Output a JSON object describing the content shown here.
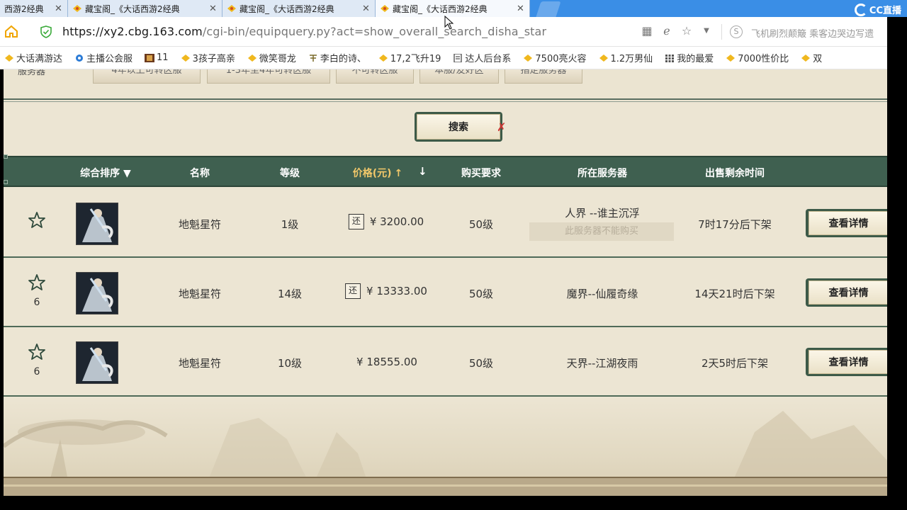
{
  "browser": {
    "tabs": [
      {
        "title": "西游2经典"
      },
      {
        "title": "藏宝阁_《大话西游2经典"
      },
      {
        "title": "藏宝阁_《大话西游2经典"
      },
      {
        "title": "藏宝阁_《大话西游2经典"
      }
    ],
    "url_domain": "https://xy2.cbg.163.com",
    "url_path": "/cgi-bin/equipquery.py?act=show_overall_search_disha_star",
    "address_hint": "飞机刷烈颠簸 乘客边哭边写遗",
    "stream_logo": "CC直播",
    "bookmarks": [
      {
        "label": "大话满游达"
      },
      {
        "label": "主播公会服"
      },
      {
        "label": "11"
      },
      {
        "label": "3孩子高亲"
      },
      {
        "label": "微笑哥龙"
      },
      {
        "label": "李白的诗、"
      },
      {
        "label": "17,2飞升19"
      },
      {
        "label": "达人后台系"
      },
      {
        "label": "7500亮火容"
      },
      {
        "label": "1.2万男仙"
      },
      {
        "label": "我的最爱"
      },
      {
        "label": "7000性价比"
      },
      {
        "label": "双"
      }
    ]
  },
  "filters": {
    "label": "服务器",
    "buttons": [
      "4年以上可转区服",
      "1-3年至4年可转区服",
      "不可转区服",
      "本服/友好区",
      "指定服务器"
    ]
  },
  "search": {
    "label": "搜索"
  },
  "table": {
    "headers": {
      "sort": "综合排序 ▼",
      "name": "名称",
      "level": "等级",
      "price": "价格(元)",
      "price_up": "↑",
      "price_down": "↓",
      "requirement": "购买要求",
      "server": "所在服务器",
      "time_left": "出售剩余时间"
    },
    "rows": [
      {
        "fav_count": "",
        "name": "地魁星符",
        "level": "1级",
        "refund_badge": "还",
        "price": "¥ 3200.00",
        "requirement": "50级",
        "server": "人界 --谁主沉浮",
        "server_note": "此服务器不能购买",
        "time_left": "7时17分后下架",
        "action": "查看详情"
      },
      {
        "fav_count": "6",
        "name": "地魁星符",
        "level": "14级",
        "refund_badge": "还",
        "price": "¥ 13333.00",
        "requirement": "50级",
        "server": "魔界--仙履奇缘",
        "server_note": "",
        "time_left": "14天21时后下架",
        "action": "查看详情"
      },
      {
        "fav_count": "6",
        "name": "地魁星符",
        "level": "10级",
        "refund_badge": "",
        "price": "¥ 18555.00",
        "requirement": "50级",
        "server": "天界--江湖夜雨",
        "server_note": "",
        "time_left": "2天5时后下架",
        "action": "查看详情"
      }
    ]
  },
  "colors": {
    "header_green": "#3f6050",
    "page_bg": "#ece5d3",
    "price_header": "#f2c86a",
    "tabbar_blue": "#3a8ee6"
  }
}
